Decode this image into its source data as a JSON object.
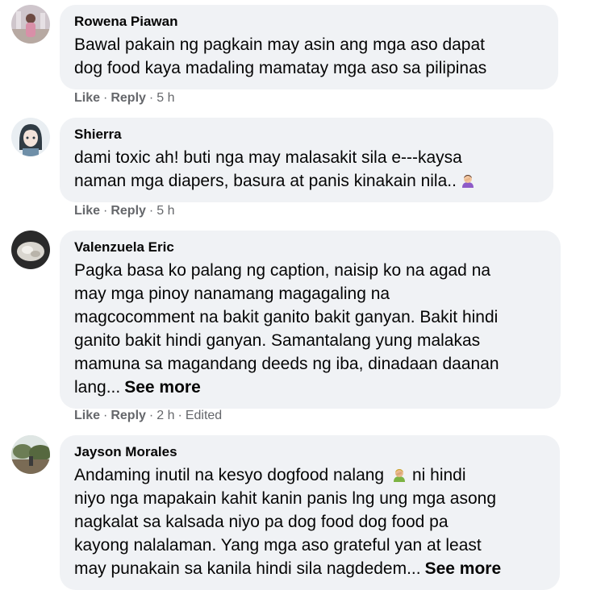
{
  "comments": [
    {
      "author": "Rowena Piawan",
      "lines": [
        "Bawal pakain ng pagkain may asin ang mga aso dapat",
        "dog food kaya madaling mamatay mga aso sa pilipinas"
      ],
      "like": "Like",
      "reply": "Reply",
      "time": "5 h"
    },
    {
      "author": "Shierra",
      "lines": [
        "dami toxic ah! buti nga may malasakit sila e---kaysa",
        "naman mga diapers, basura at panis kinakain nila.."
      ],
      "emoji": "person-facepalming-emoji",
      "like": "Like",
      "reply": "Reply",
      "time": "5 h"
    },
    {
      "author": "Valenzuela Eric",
      "lines": [
        "Pagka basa ko palang ng caption, naisip ko na agad na",
        "may mga pinoy nanamang magagaling na",
        "magcocomment na bakit ganito bakit ganyan. Bakit hindi",
        "ganito bakit hindi ganyan. Samantalang yung malakas",
        "mamuna sa magandang deeds ng iba, dinadaan daanan",
        "lang..."
      ],
      "see_more": "See more",
      "like": "Like",
      "reply": "Reply",
      "time": "2 h",
      "edited": "Edited"
    },
    {
      "author": "Jayson Morales",
      "lines": [
        "Andaming inutil na kesyo dogfood nalang",
        "niyo nga mapakain kahit kanin panis lng ung mga asong",
        "nagkalat sa kalsada niyo pa dog food dog food pa",
        "kayong nalalaman. Yang mga aso grateful yan at least",
        "may punakain sa kanila hindi sila nagdedem..."
      ],
      "emoji": "person-facepalming-emoji",
      "see_more": "See more"
    }
  ],
  "separator": "·"
}
